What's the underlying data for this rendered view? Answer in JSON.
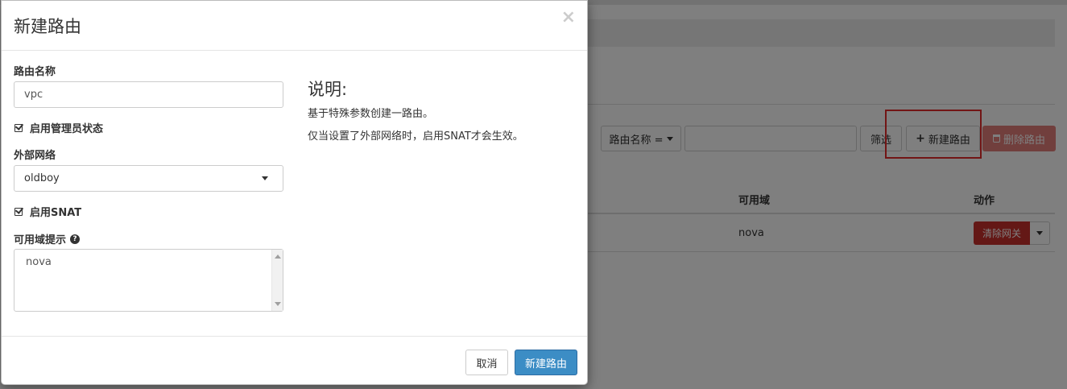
{
  "background": {
    "filter": {
      "select_label": "路由名称 =",
      "filter_button": "筛选",
      "create_button": "新建路由",
      "delete_button": "删除路由"
    },
    "table": {
      "columns": [
        "可用域",
        "动作"
      ],
      "rows": [
        {
          "availability_zone": "nova",
          "action_label": "清除网关"
        }
      ]
    }
  },
  "modal": {
    "title": "新建路由",
    "close_glyph": "×",
    "form": {
      "router_name_label": "路由名称",
      "router_name_value": "vpc",
      "admin_state_label": "启用管理员状态",
      "external_network_label": "外部网络",
      "external_network_value": "oldboy",
      "snat_label": "启用SNAT",
      "az_hint_label": "可用域提示",
      "az_hint_help_glyph": "?",
      "az_hint_value": "nova"
    },
    "description": {
      "title": "说明:",
      "lines": [
        "基于特殊参数创建一路由。",
        "仅当设置了外部网络时，启用SNAT才会生效。"
      ]
    },
    "footer": {
      "cancel_label": "取消",
      "submit_label": "新建路由"
    }
  },
  "colors": {
    "primary": "#3c8dc5",
    "danger": "#c9302c",
    "highlight": "#e52a2a"
  }
}
